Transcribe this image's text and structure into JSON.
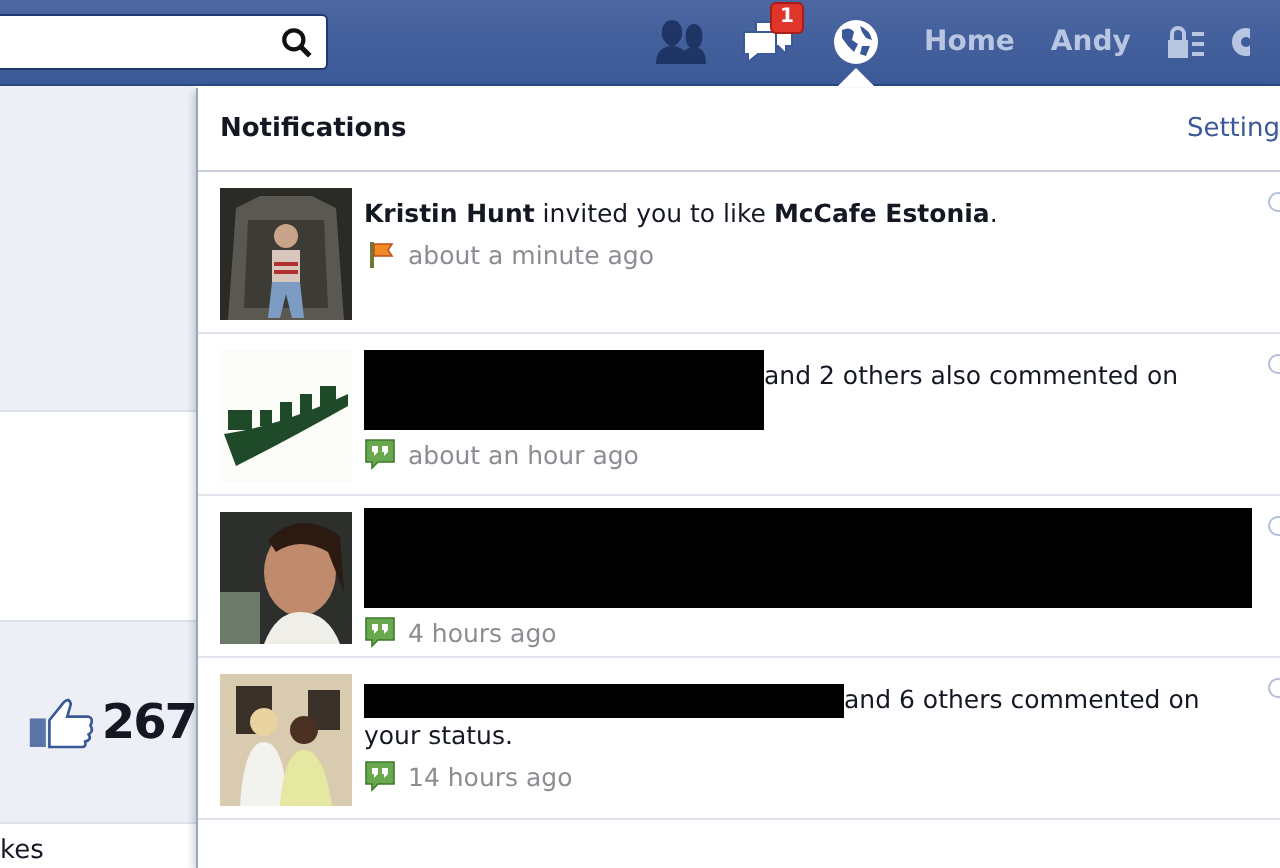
{
  "topbar": {
    "nav_icons": [
      {
        "kind": "friends",
        "selected": false
      },
      {
        "kind": "messages",
        "selected": false,
        "badge": "1"
      },
      {
        "kind": "notifications",
        "selected": true
      }
    ],
    "links": [
      "Home",
      "Andy"
    ]
  },
  "page": {
    "like_count": "267",
    "likes_label": "kes"
  },
  "notifications": {
    "title": "Notifications",
    "settings_link": "Setting",
    "items": [
      {
        "kind": "invite",
        "message": [
          {
            "kind": "bold",
            "text": "Kristin Hunt"
          },
          {
            "kind": "plain",
            "text": " invited you to like "
          },
          {
            "kind": "bold",
            "text": "McCafe Estonia"
          },
          {
            "kind": "plain",
            "text": "."
          }
        ],
        "time": "about a minute ago"
      },
      {
        "kind": "comment",
        "message": [
          {
            "kind": "mask-tall"
          },
          {
            "kind": "plain",
            "text": "and 2 others also commented on"
          }
        ],
        "time": "about an hour ago"
      },
      {
        "kind": "comment",
        "message": [
          {
            "kind": "mask-full"
          }
        ],
        "time": "4 hours ago"
      },
      {
        "kind": "comment",
        "message": [
          {
            "kind": "mask-inline"
          },
          {
            "kind": "plain",
            "text": "and 6 others commented on your status."
          }
        ],
        "time": "14 hours ago"
      }
    ]
  }
}
